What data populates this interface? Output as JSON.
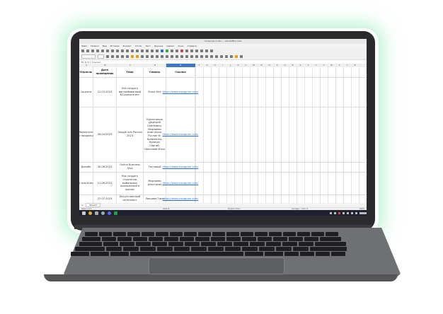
{
  "window": {
    "title": "Unnamed-1.xlsx — LibreOffice Calc"
  },
  "menu": [
    "Файл",
    "Правка",
    "Вид",
    "Вставка",
    "Формат",
    "Стили",
    "Лист",
    "Данные",
    "Сервис",
    "Окно",
    "Справка"
  ],
  "formula_bar": {
    "cell_ref": "E1",
    "value": "Ссылки"
  },
  "columns": [
    "A",
    "B",
    "C",
    "D",
    "E",
    "F",
    "G",
    "H",
    "I",
    "J",
    "K",
    "L",
    "M",
    "N",
    "O",
    "P",
    "Q",
    "R",
    "S",
    "T",
    "U",
    "V",
    "W",
    "X",
    "Y",
    "Z"
  ],
  "selected_column": "E",
  "table": {
    "headers": [
      "Отрасль",
      "Дата проведения",
      "Тема",
      "Спикер",
      "Ссылка"
    ],
    "rows": [
      {
        "a": "Соцсети",
        "date": "12.03.2023",
        "topic": "Как создать востребованный NT-консалтинг",
        "speaker": "Shout Kirk",
        "link": "https://www.instagram.com/"
      },
      {
        "a": "Маркетинг и продажи",
        "date": "28.04.2023",
        "topic": "Google Ads Россия 2023",
        "speaker": "Колесников Дмитрий Сергеевич, Мирзоева Анастасия, Руслан Ф. Кравченко, Кравчук Сергей, Николаев Илья",
        "link": "https://www.instagram.com/"
      },
      {
        "a": "Дизайн",
        "date": "30.06.2023",
        "topic": "Online Business Q&A",
        "speaker": "Тестовый",
        "link": "https://www.instagram.com/"
      },
      {
        "a": "Стратегия",
        "date": "21.06.2023",
        "topic": "Как создать стратегию мобильных приложений в кризис",
        "speaker": "Мирзаева Анастасия",
        "link": "https://www.instagram.com/"
      },
      {
        "a": "",
        "date": "27.07.2023",
        "topic": "Искусственный интеллект",
        "speaker": "Ланцова Тина",
        "link": "https://www.instagram.com/"
      }
    ]
  },
  "sheet_tab": "Sheet1",
  "status": {
    "page": "Page 1 of 1",
    "style": "Default",
    "language": "English (USA)",
    "sum": "Average: ; Sum: 0",
    "zoom": "100%"
  },
  "colors": {
    "accent": "#3b79c6",
    "link": "#2a6fd6",
    "glow": "#78e6aa"
  }
}
